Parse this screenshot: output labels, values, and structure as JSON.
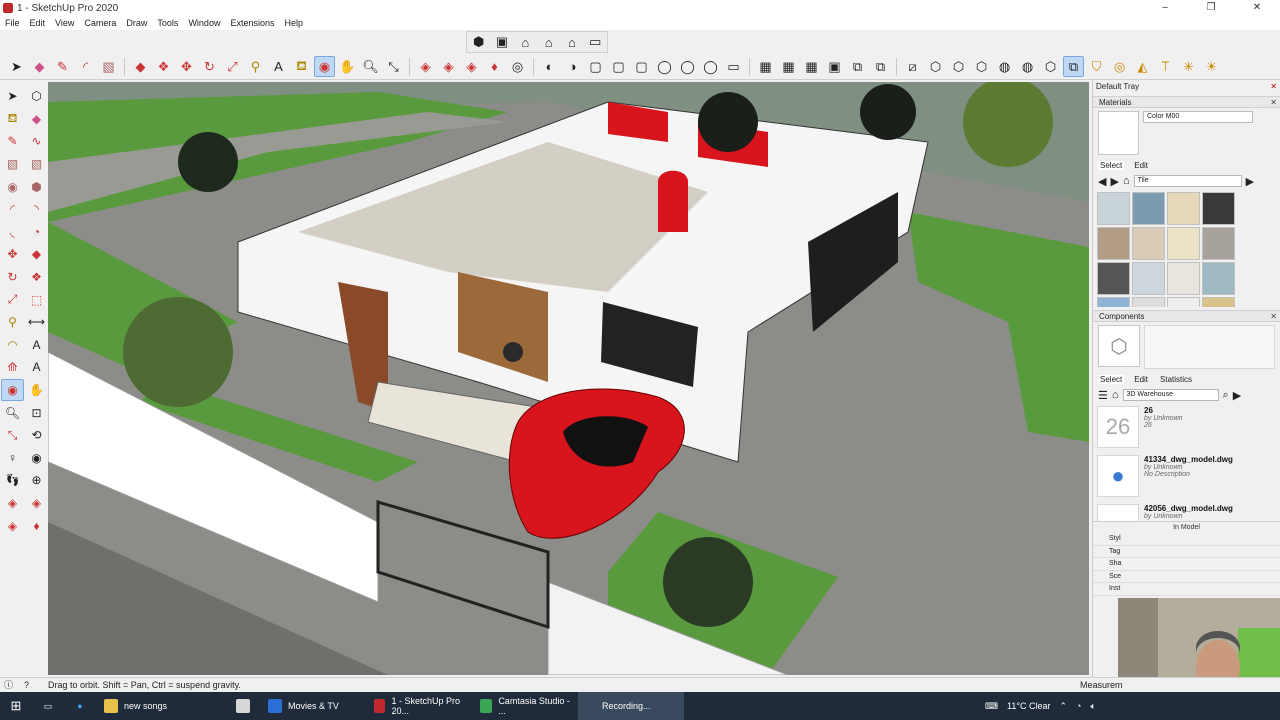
{
  "window": {
    "title": "1 - SketchUp Pro 2020",
    "min": "–",
    "max": "❐",
    "close": "✕"
  },
  "menu": [
    "File",
    "Edit",
    "View",
    "Camera",
    "Draw",
    "Tools",
    "Window",
    "Extensions",
    "Help"
  ],
  "tray": {
    "title": "Default Tray",
    "materials": {
      "header": "Materials",
      "name": "Color M00",
      "tab_select": "Select",
      "tab_edit": "Edit",
      "library": "Tile",
      "tile_colors": [
        "#c9d4d8",
        "#7a9bb0",
        "#e6d9b8",
        "#3a3a3a",
        "#b39c85",
        "#d9cbb5",
        "#ece2c6",
        "#a7a39c",
        "#555555",
        "#cdd6dd",
        "#e8e4de",
        "#9eb9c1",
        "#8fb4d6",
        "#ddd",
        "#eee",
        "#d8c38a"
      ]
    },
    "components": {
      "header": "Components",
      "tab_select": "Select",
      "tab_edit": "Edit",
      "tab_stats": "Statistics",
      "search": "3D Warehouse",
      "items": [
        {
          "name": "26",
          "by": "by Unknown",
          "desc": "26",
          "thumb": "26"
        },
        {
          "name": "41334_dwg_model.dwg",
          "by": "by Unknown",
          "desc": "No Description",
          "thumb": "●"
        },
        {
          "name": "42056_dwg_model.dwg",
          "by": "by Unknown",
          "desc": "",
          "thumb": ""
        }
      ],
      "in_model": "In Model"
    },
    "collapsed": [
      "Styl",
      "Tag",
      "Sha",
      "Sce",
      "Inst"
    ]
  },
  "status": {
    "message": "Drag to orbit. Shift = Pan, Ctrl = suspend gravity.",
    "measurements": "Measurem"
  },
  "taskbar": {
    "items": [
      {
        "label": "new songs",
        "color": "#e8c14a",
        "active": false
      },
      {
        "label": "",
        "color": "#d7d7d7",
        "active": false
      },
      {
        "label": "Movies & TV",
        "color": "#2a6fd6",
        "active": false
      },
      {
        "label": "1 - SketchUp Pro 20...",
        "color": "#c0282d",
        "active": false
      },
      {
        "label": "Camtasia Studio - ...",
        "color": "#3aa655",
        "active": false
      },
      {
        "label": "Recording...",
        "color": "#3a4a5e",
        "active": true
      }
    ],
    "weather": "11°C  Clear",
    "clock_icon": "wifi-icon"
  },
  "colors": {
    "grass": "#5a9a3e",
    "paving": "#8a8a85",
    "wall": "#ffffff",
    "accent_red": "#d8141c",
    "active_tool": "#bfd9f5"
  }
}
